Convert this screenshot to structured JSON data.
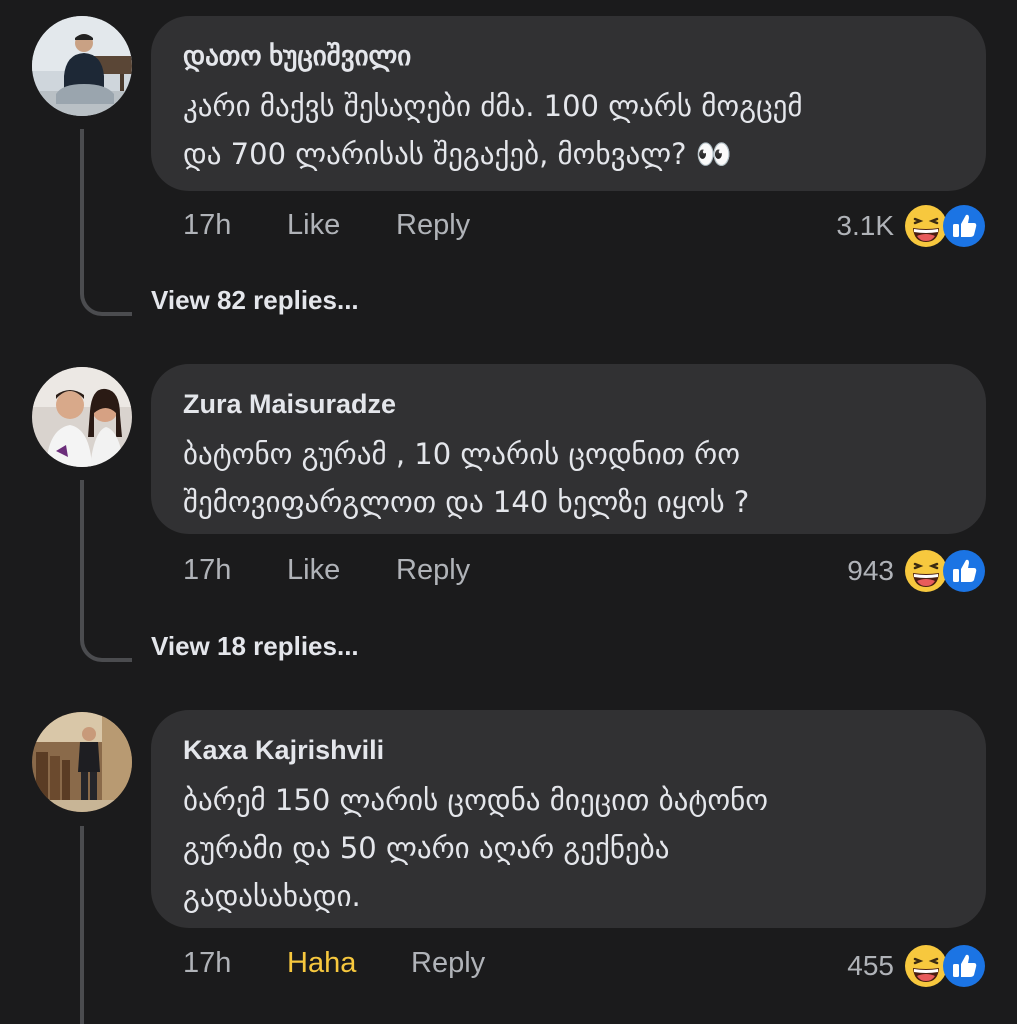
{
  "comments": [
    {
      "author": "დათო ხუციშვილი",
      "text": "კარი მაქვს შესაღები ძმა. 100 ლარს მოგცემ\nდა 700 ლარისას შეგაქებ, მოხვალ? 👀",
      "time": "17h",
      "like_label": "Like",
      "reply_label": "Reply",
      "reaction_count": "3.1K",
      "view_replies": "View 82 replies..."
    },
    {
      "author": "Zura Maisuradze",
      "text": "ბატონო გურამ , 10 ლარის ცოდნით რო\nშემოვიფარგლოთ და 140 ხელზე იყოს ?",
      "time": "17h",
      "like_label": "Like",
      "reply_label": "Reply",
      "reaction_count": "943",
      "view_replies": "View 18 replies..."
    },
    {
      "author": "Kaxa Kajrishvili",
      "text": "ბარემ 150 ლარის ცოდნა მიეცით ბატონო\nგურამი და 50 ლარი აღარ გექნება\nგადასახადი.",
      "time": "17h",
      "like_label": "Haha",
      "reply_label": "Reply",
      "reaction_count": "455"
    }
  ],
  "colors": {
    "background": "#1b1b1c",
    "bubble": "#313133",
    "text_primary": "#e4e6eb",
    "text_secondary": "#b0b3b8",
    "haha_active": "#f7c83e",
    "like_blue": "#1b74e4"
  },
  "icons": [
    "haha-emoji-icon",
    "like-thumb-icon"
  ]
}
